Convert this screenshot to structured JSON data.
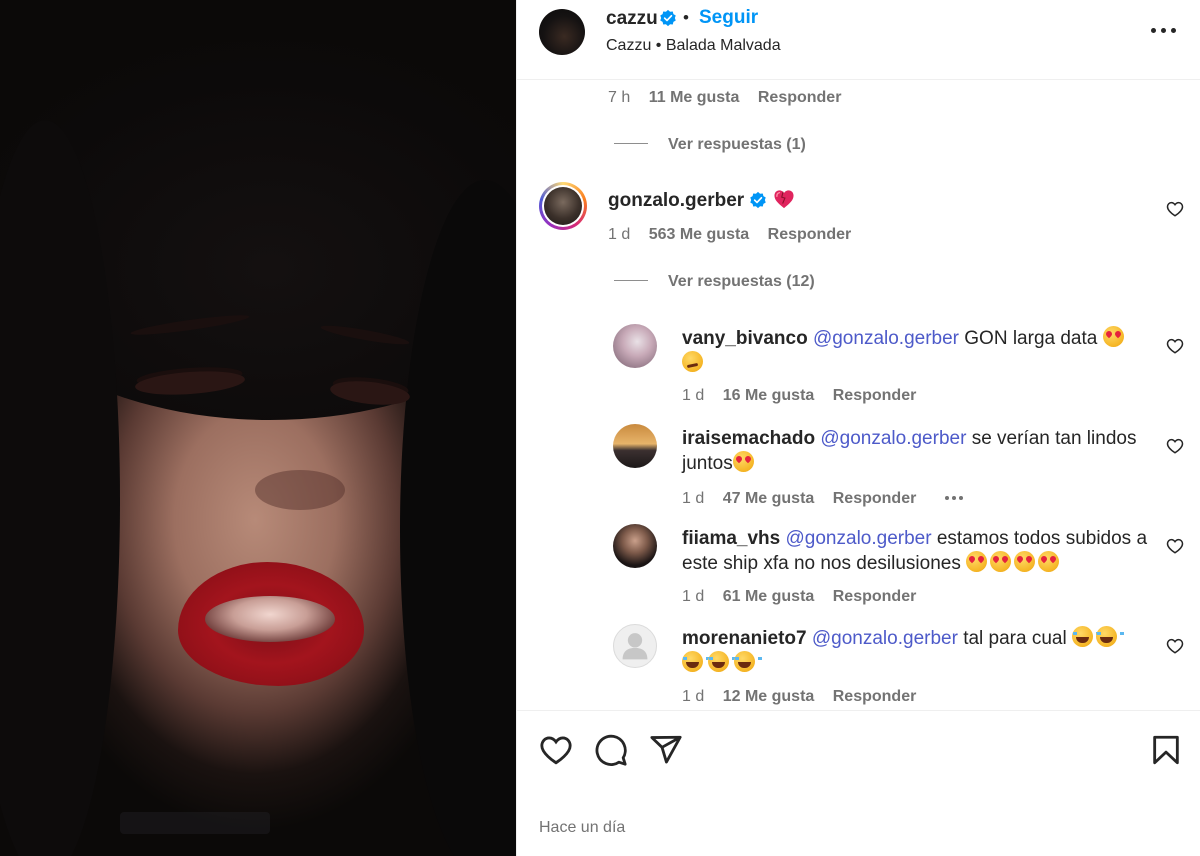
{
  "header": {
    "username": "cazzu",
    "follow_label": "Seguir",
    "subtitle": "Cazzu • Balada Malvada"
  },
  "comments": {
    "first_meta": {
      "time": "7 h",
      "likes": "11 Me gusta",
      "reply": "Responder"
    },
    "first_view_replies": "Ver respuestas (1)",
    "main_comment": {
      "username": "gonzalo.gerber",
      "emoji": "heart-icon",
      "time": "1 d",
      "likes": "563 Me gusta",
      "reply": "Responder",
      "view_replies": "Ver respuestas (12)"
    },
    "replies": [
      {
        "username": "vany_bivanco",
        "mention": "@gonzalo.gerber",
        "text": "GON larga data",
        "time": "1 d",
        "likes": "16 Me gusta",
        "reply": "Responder"
      },
      {
        "username": "iraisemachado",
        "mention": "@gonzalo.gerber",
        "text": "se verían tan lindos juntos",
        "time": "1 d",
        "likes": "47 Me gusta",
        "reply": "Responder"
      },
      {
        "username": "fiiama_vhs",
        "mention": "@gonzalo.gerber",
        "text": "estamos todos subidos a este ship xfa no nos desilusiones",
        "time": "1 d",
        "likes": "61 Me gusta",
        "reply": "Responder"
      },
      {
        "username": "morenanieto7",
        "mention": "@gonzalo.gerber",
        "text": "tal para cual",
        "time": "1 d",
        "likes": "12 Me gusta",
        "reply": "Responder"
      }
    ]
  },
  "footer": {
    "timestamp": "Hace un día"
  },
  "colors": {
    "accent": "#0095f6",
    "mention": "#4d5ac9",
    "muted": "#737373",
    "lipstick": "#a3141d"
  }
}
